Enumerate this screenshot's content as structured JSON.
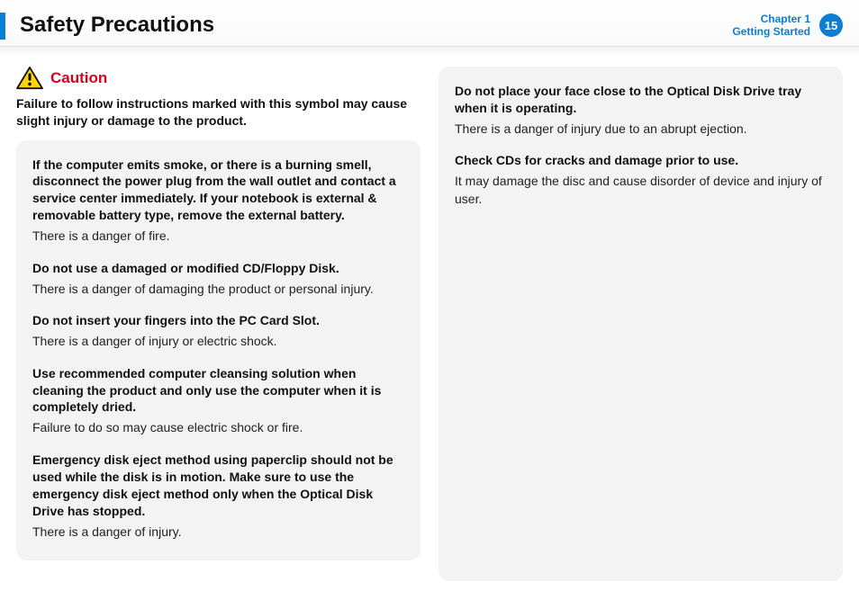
{
  "header": {
    "title": "Safety Precautions",
    "chapter_line1": "Chapter 1",
    "chapter_line2": "Getting Started",
    "page_number": "15"
  },
  "caution": {
    "label": "Caution",
    "description": "Failure to follow instructions marked with this symbol may cause slight injury or damage to the product."
  },
  "left_items": [
    {
      "head": "If the computer emits smoke, or there is a burning smell, disconnect the power plug from the wall outlet and contact a service center immediately. If your notebook is external & removable battery type, remove the external battery.",
      "body": "There is a danger of fire."
    },
    {
      "head": "Do not use a damaged or modified CD/Floppy Disk.",
      "body": "There is a danger of damaging the product or personal injury."
    },
    {
      "head": "Do not insert your fingers into the PC Card Slot.",
      "body": "There is a danger of injury or electric shock."
    },
    {
      "head": "Use recommended computer cleansing solution when cleaning the product and only use the computer when it is completely dried.",
      "body": "Failure to do so may cause electric shock or fire."
    },
    {
      "head": "Emergency disk eject method using paperclip should not be used while the disk is in motion. Make sure to use the emergency disk eject method only when the Optical Disk Drive has stopped.",
      "body": "There is a danger of injury."
    }
  ],
  "right_items": [
    {
      "head": "Do not place your face close to the Optical Disk Drive tray when it is operating.",
      "body": "There is a danger of injury due to an abrupt ejection."
    },
    {
      "head": "Check CDs for cracks and damage prior to use.",
      "body": "It may damage the disc and cause disorder of device and injury of user."
    }
  ]
}
